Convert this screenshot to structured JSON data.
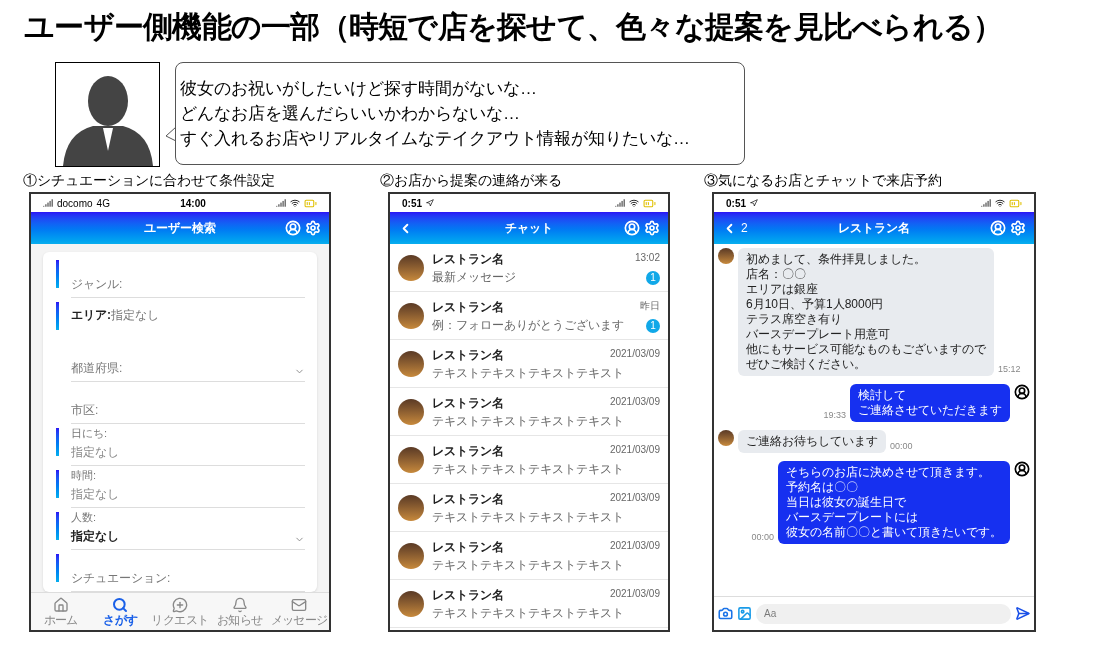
{
  "title": "ユーザー側機能の一部（時短で店を探せて、色々な提案を見比べられる）",
  "speech_lines": [
    "彼女のお祝いがしたいけど探す時間がないな…",
    "どんなお店を選んだらいいかわからないな…",
    "すぐ入れるお店やリアルタイムなテイクアウト情報が知りたいな…"
  ],
  "screens": {
    "search": {
      "caption": "①シチュエーションに合わせて条件設定",
      "status": {
        "carrier": "docomo",
        "network": "4G",
        "time": "14:00"
      },
      "header_title": "ユーザー検索",
      "fields": [
        {
          "kind": "plain",
          "label": "ジャンル:",
          "accent": true,
          "dropdown": false
        },
        {
          "kind": "heading",
          "label": "**エリア:**指定なし",
          "accent": true,
          "dropdown": false
        },
        {
          "kind": "plain",
          "label": "都道府県:",
          "accent": false,
          "dropdown": true
        },
        {
          "kind": "plain",
          "label": "市区:",
          "accent": false,
          "dropdown": false
        },
        {
          "kind": "valued",
          "label": "日にち:",
          "placeholder": "指定なし",
          "accent": true,
          "dropdown": false
        },
        {
          "kind": "valued",
          "label": "時間:",
          "placeholder": "指定なし",
          "accent": true,
          "dropdown": false
        },
        {
          "kind": "valued",
          "label": "人数:",
          "value": "指定なし",
          "accent": true,
          "dropdown": true
        },
        {
          "kind": "plain",
          "label": "シチュエーション:",
          "accent": true,
          "dropdown": false
        }
      ],
      "tabs": [
        {
          "kind": "home",
          "label": "ホーム",
          "selected": false
        },
        {
          "kind": "search",
          "label": "さがす",
          "selected": true
        },
        {
          "kind": "request",
          "label": "リクエスト",
          "selected": false
        },
        {
          "kind": "notice",
          "label": "お知らせ",
          "selected": false
        },
        {
          "kind": "message",
          "label": "メッセージ",
          "selected": false
        }
      ]
    },
    "chat_list": {
      "caption": "②お店から提案の連絡が来る",
      "status": {
        "time": "0:51"
      },
      "header_title": "チャット",
      "rows": [
        {
          "name": "レストラン名",
          "message": "最新メッセージ",
          "time": "13:02",
          "unread": "1"
        },
        {
          "name": "レストラン名",
          "message": "例：フォローありがとうございます",
          "time": "昨日",
          "unread": "1"
        },
        {
          "name": "レストラン名",
          "message": "テキストテキストテキストテキスト",
          "time": "2021/03/09"
        },
        {
          "name": "レストラン名",
          "message": "テキストテキストテキストテキスト",
          "time": "2021/03/09"
        },
        {
          "name": "レストラン名",
          "message": "テキストテキストテキストテキスト",
          "time": "2021/03/09"
        },
        {
          "name": "レストラン名",
          "message": "テキストテキストテキストテキスト",
          "time": "2021/03/09"
        },
        {
          "name": "レストラン名",
          "message": "テキストテキストテキストテキスト",
          "time": "2021/03/09"
        },
        {
          "name": "レストラン名",
          "message": "テキストテキストテキストテキスト",
          "time": "2021/03/09"
        }
      ]
    },
    "chat": {
      "caption": "③気になるお店とチャットで来店予約",
      "status": {
        "time": "0:51"
      },
      "back_count": "2",
      "header_title": "レストラン名",
      "messages": [
        {
          "kind": "incoming",
          "lines": [
            "初めまして、条件拝見しました。",
            "店名：〇〇",
            "エリアは銀座",
            "6月10日、予算1人8000円",
            "テラス席空き有り",
            "バースデープレート用意可",
            "他にもサービス可能なものもございますので",
            "ぜひご検討ください。"
          ],
          "time": "15:12"
        },
        {
          "kind": "outgoing",
          "lines": [
            "検討して",
            "ご連絡させていただきます"
          ],
          "time": "19:33"
        },
        {
          "kind": "incoming",
          "lines": [
            "ご連絡お待ちしています"
          ],
          "time": "00:00"
        },
        {
          "kind": "outgoing",
          "lines": [
            "そちらのお店に決めさせて頂きます。",
            "予約名は〇〇",
            "当日は彼女の誕生日で",
            "バースデープレートには",
            "彼女の名前〇〇と書いて頂きたいです。"
          ],
          "time": "00:00"
        }
      ],
      "input_placeholder": "Aa"
    }
  }
}
